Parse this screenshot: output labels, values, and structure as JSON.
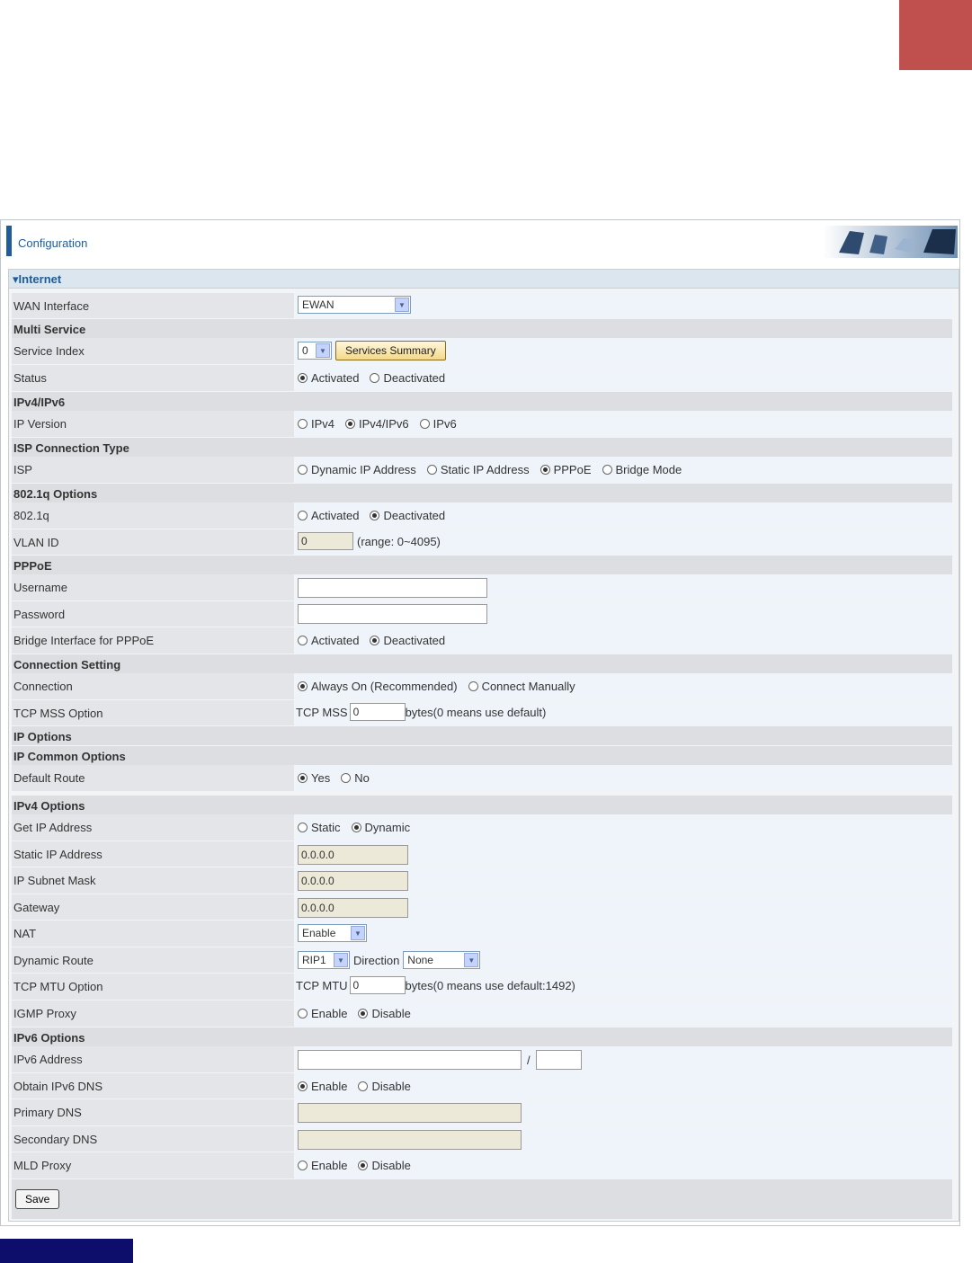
{
  "header": {
    "title": "Configuration"
  },
  "panel": {
    "title": "Internet"
  },
  "sections": {
    "multi_service": "Multi Service",
    "ipv4ipv6": "IPv4/IPv6",
    "isp_conn": "ISP Connection Type",
    "dot1q": "802.1q Options",
    "pppoe": "PPPoE",
    "conn_setting": "Connection Setting",
    "ip_options": "IP Options",
    "ip_common": "IP Common Options",
    "ipv4_options": "IPv4 Options",
    "ipv6_options": "IPv6 Options"
  },
  "fields": {
    "wan_interface": {
      "label": "WAN Interface",
      "value": "EWAN"
    },
    "service_index": {
      "label": "Service Index",
      "value": "0",
      "button": "Services Summary"
    },
    "status": {
      "label": "Status",
      "opt1": "Activated",
      "opt2": "Deactivated"
    },
    "ip_version": {
      "label": "IP Version",
      "opt1": "IPv4",
      "opt2": "IPv4/IPv6",
      "opt3": "IPv6"
    },
    "isp": {
      "label": "ISP",
      "opt1": "Dynamic IP Address",
      "opt2": "Static IP Address",
      "opt3": "PPPoE",
      "opt4": "Bridge Mode"
    },
    "dot1q": {
      "label": "802.1q",
      "opt1": "Activated",
      "opt2": "Deactivated"
    },
    "vlan_id": {
      "label": "VLAN ID",
      "value": "0",
      "hint": "(range: 0~4095)"
    },
    "username": {
      "label": "Username",
      "value": ""
    },
    "password": {
      "label": "Password",
      "value": ""
    },
    "bridge_pppoe": {
      "label": "Bridge Interface for PPPoE",
      "opt1": "Activated",
      "opt2": "Deactivated"
    },
    "connection": {
      "label": "Connection",
      "opt1": "Always On (Recommended)",
      "opt2": "Connect Manually"
    },
    "tcp_mss": {
      "label": "TCP MSS Option",
      "prefix": "TCP MSS",
      "value": "0",
      "hint": "bytes(0 means use default)"
    },
    "default_route": {
      "label": "Default Route",
      "opt1": "Yes",
      "opt2": "No"
    },
    "get_ip": {
      "label": "Get IP Address",
      "opt1": "Static",
      "opt2": "Dynamic"
    },
    "static_ip": {
      "label": "Static IP Address",
      "value": "0.0.0.0"
    },
    "subnet": {
      "label": "IP Subnet Mask",
      "value": "0.0.0.0"
    },
    "gateway": {
      "label": "Gateway",
      "value": "0.0.0.0"
    },
    "nat": {
      "label": "NAT",
      "value": "Enable"
    },
    "dynamic_route": {
      "label": "Dynamic Route",
      "value": "RIP1",
      "dir_label": "Direction",
      "dir_value": "None"
    },
    "tcp_mtu": {
      "label": "TCP MTU Option",
      "prefix": "TCP MTU",
      "value": "0",
      "hint": "bytes(0 means use default:1492)"
    },
    "igmp": {
      "label": "IGMP Proxy",
      "opt1": "Enable",
      "opt2": "Disable"
    },
    "ipv6_addr": {
      "label": "IPv6 Address",
      "value": "",
      "slash": "/",
      "prefix_len": ""
    },
    "ipv6_dns": {
      "label": "Obtain IPv6 DNS",
      "opt1": "Enable",
      "opt2": "Disable"
    },
    "primary_dns": {
      "label": "Primary DNS",
      "value": ""
    },
    "secondary_dns": {
      "label": "Secondary DNS",
      "value": ""
    },
    "mld": {
      "label": "MLD Proxy",
      "opt1": "Enable",
      "opt2": "Disable"
    }
  },
  "actions": {
    "save": "Save"
  },
  "colors": {
    "accent": "#1f5c99",
    "corner_red": "#c0504d",
    "navy": "#0d0d6b"
  }
}
